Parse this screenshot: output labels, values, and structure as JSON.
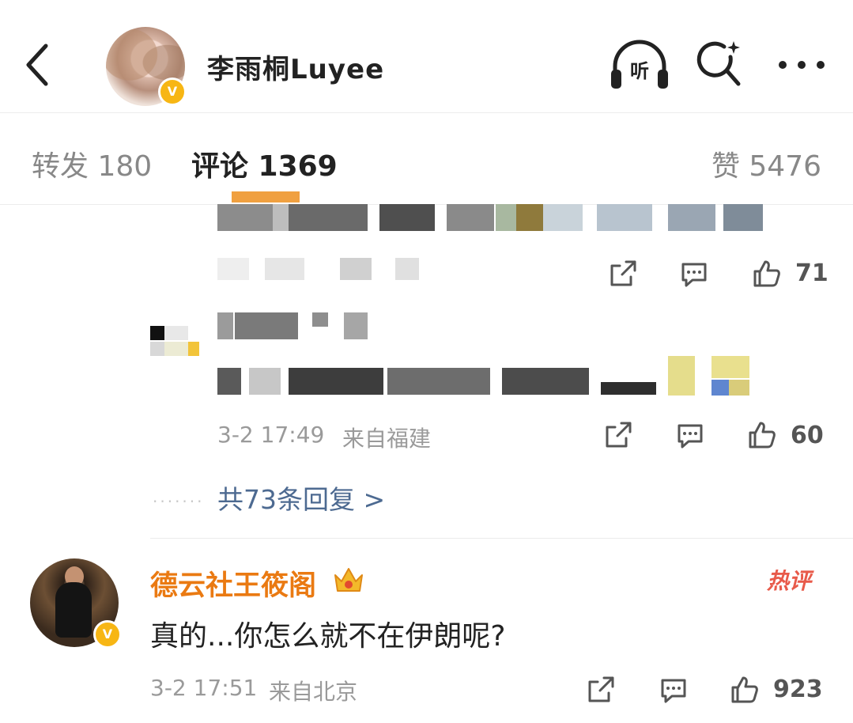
{
  "header": {
    "title": "李雨桐Luyee",
    "listen_label": "听",
    "verified_badge": "V"
  },
  "tabs": {
    "repost": "转发 180",
    "comment": "评论 1369",
    "like": "赞 5476"
  },
  "comments": [
    {
      "like_count": "71"
    },
    {
      "time": "3-2 17:49",
      "location": "来自福建",
      "like_count": "60",
      "replies_link": "共73条回复 >"
    },
    {
      "author": "德云社王筱阁",
      "verified_badge": "V",
      "hot_badge": "热评",
      "text": "真的...你怎么就不在伊朗呢?",
      "time": "3-2 17:51",
      "location": "来自北京",
      "like_count": "923"
    }
  ],
  "icons": {
    "back": "chevron-left-icon",
    "listen": "headphones-icon",
    "search": "search-sparkle-icon",
    "more": "more-horizontal-icon",
    "share": "share-icon",
    "comment": "comment-bubble-icon",
    "like": "thumbs-up-icon",
    "crown": "crown-icon"
  },
  "colors": {
    "accent_orange": "#ea7a12",
    "verified_yellow": "#f7b614",
    "link_blue": "#4d6a91",
    "hot_red": "#e85a4a"
  }
}
